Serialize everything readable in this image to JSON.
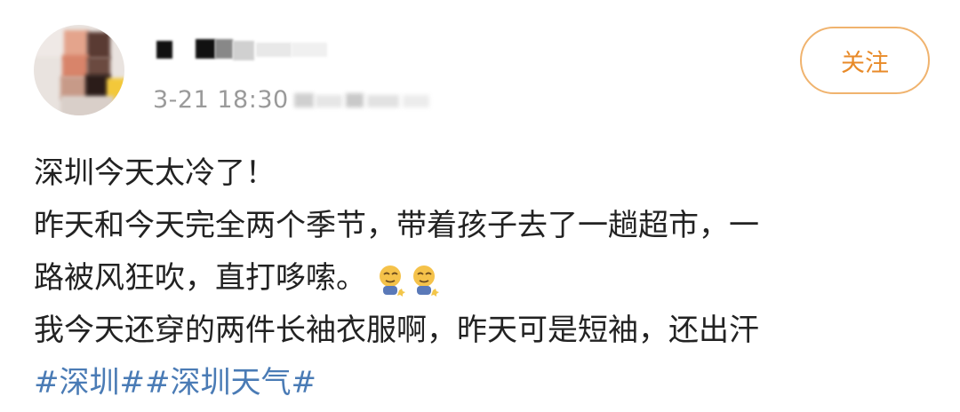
{
  "header": {
    "timestamp": "3-21 18:30",
    "follow_label": "关注"
  },
  "post": {
    "lines": [
      "深圳今天太冷了！",
      "昨天和今天完全两个季节，带着孩子去了一趟超市，一",
      "路被风狂吹，直打哆嗦。",
      "我今天还穿的两件长袖衣服啊，昨天可是短袖，还出汗"
    ],
    "emoji_icons": [
      "shivering-face-icon",
      "shivering-face-icon"
    ],
    "hashtags": [
      "#深圳#",
      "#深圳天气#"
    ]
  },
  "colors": {
    "accent_orange": "#e88a28",
    "follow_border": "#f0b36e",
    "hashtag_blue": "#4a7bb5",
    "meta_gray": "#9a9a9a",
    "body_text": "#222222"
  }
}
